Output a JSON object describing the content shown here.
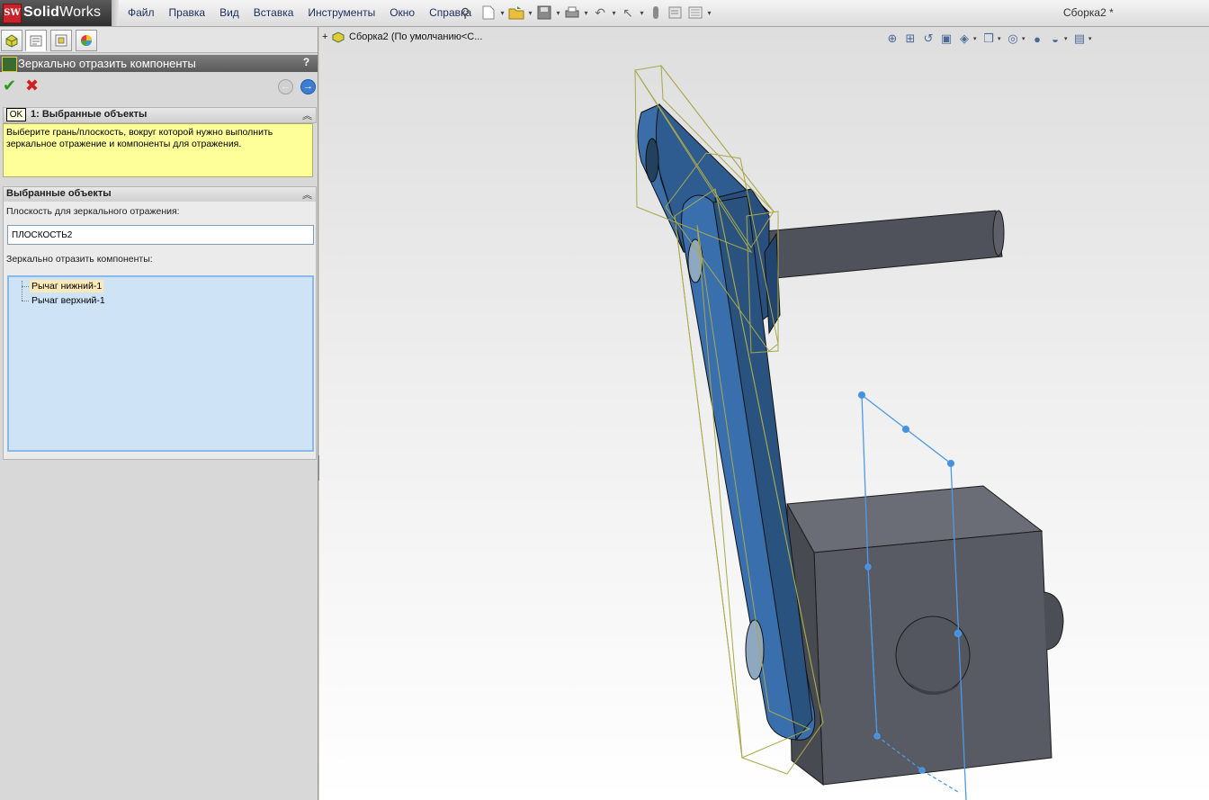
{
  "app": {
    "logo_mark": "SW",
    "logo_bold": "Solid",
    "logo_light": "Works",
    "document_title": "Сборка2 *"
  },
  "menu": [
    "Файл",
    "Правка",
    "Вид",
    "Вставка",
    "Инструменты",
    "Окно",
    "Справка"
  ],
  "toolbar_icons": [
    "new-document-icon",
    "open-folder-icon",
    "save-icon",
    "print-icon",
    "undo-icon",
    "select-pointer-icon",
    "rebuild-icon",
    "file-properties-icon",
    "options-icon"
  ],
  "panel_tabs": [
    "feature-manager-tab",
    "property-manager-tab",
    "configuration-manager-tab",
    "appearance-manager-tab"
  ],
  "property_manager": {
    "title": "Зеркально отразить компоненты",
    "help": "?",
    "ok_tooltip": "OK",
    "step_group": {
      "title": "1: Выбранные объекты",
      "message": "Выберите грань/плоскость, вокруг которой нужно выполнить зеркальное отражение и компоненты для отражения."
    },
    "selections_group": {
      "title": "Выбранные объекты",
      "plane_label": "Плоскость для зеркального отражения:",
      "plane_value": "ПЛОСКОСТЬ2",
      "components_label": "Зеркально отразить компоненты:",
      "components": [
        "Рычаг нижний-1",
        "Рычаг верхний-1"
      ]
    }
  },
  "viewport": {
    "tree_root": "Сборка2  (По умолчанию<С...",
    "view_tools": [
      "zoom-to-fit-icon",
      "zoom-to-area-icon",
      "previous-view-icon",
      "section-view-icon",
      "view-orientation-icon",
      "display-style-icon",
      "hide-show-items-icon",
      "edit-appearance-icon",
      "apply-scene-icon",
      "view-settings-icon"
    ]
  },
  "colors": {
    "blue_part": "#34659b",
    "gray_part": "#5b5e66",
    "plane": "#4a9be8",
    "highlight": "#a8a84a"
  }
}
